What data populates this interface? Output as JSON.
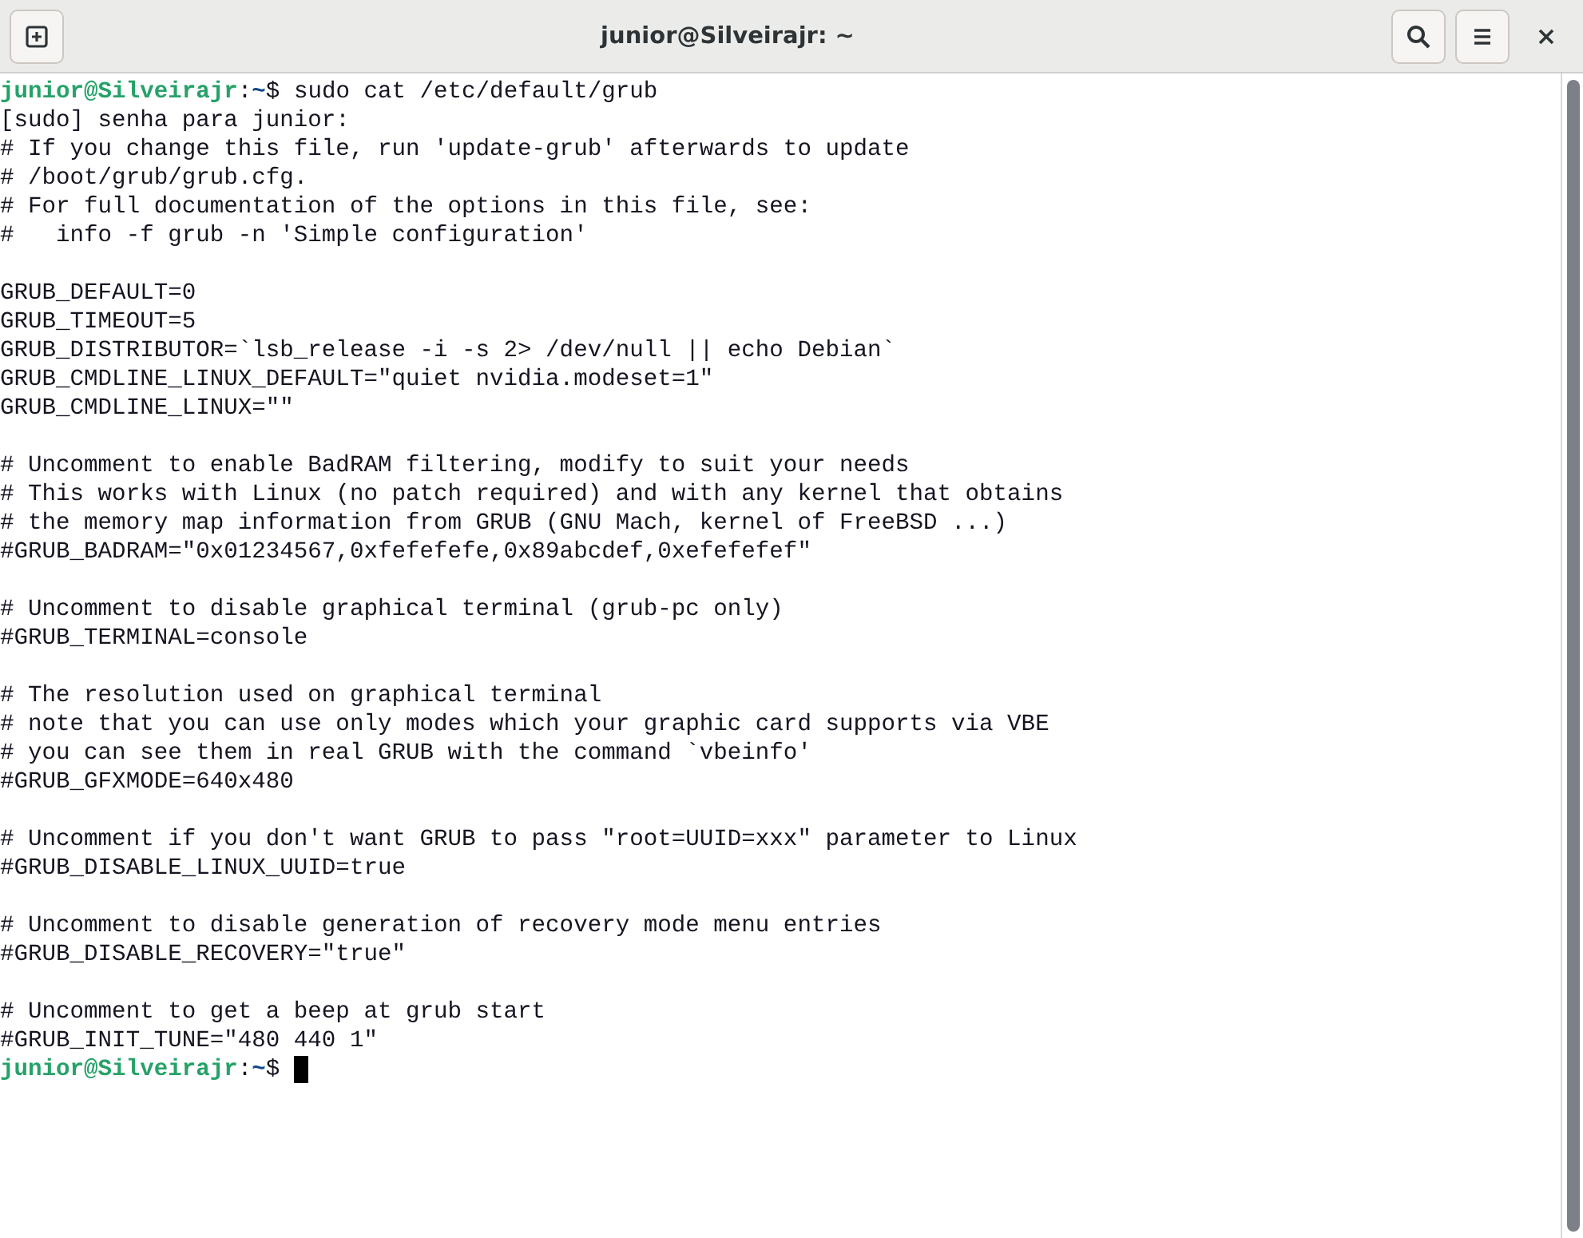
{
  "window": {
    "title": "junior@Silveirajr: ~"
  },
  "lines": [
    {
      "kind": "prompt",
      "user_host": "junior@Silveirajr",
      "separator": ":",
      "path": "~",
      "symbol": "$",
      "command": "sudo cat /etc/default/grub"
    },
    {
      "kind": "output",
      "text": "[sudo] senha para junior:"
    },
    {
      "kind": "output",
      "text": "# If you change this file, run 'update-grub' afterwards to update"
    },
    {
      "kind": "output",
      "text": "# /boot/grub/grub.cfg."
    },
    {
      "kind": "output",
      "text": "# For full documentation of the options in this file, see:"
    },
    {
      "kind": "output",
      "text": "#   info -f grub -n 'Simple configuration'"
    },
    {
      "kind": "blank"
    },
    {
      "kind": "output",
      "text": "GRUB_DEFAULT=0"
    },
    {
      "kind": "output",
      "text": "GRUB_TIMEOUT=5"
    },
    {
      "kind": "output",
      "text": "GRUB_DISTRIBUTOR=`lsb_release -i -s 2> /dev/null || echo Debian`"
    },
    {
      "kind": "output",
      "text": "GRUB_CMDLINE_LINUX_DEFAULT=\"quiet nvidia.modeset=1\""
    },
    {
      "kind": "output",
      "text": "GRUB_CMDLINE_LINUX=\"\""
    },
    {
      "kind": "blank"
    },
    {
      "kind": "output",
      "text": "# Uncomment to enable BadRAM filtering, modify to suit your needs"
    },
    {
      "kind": "output",
      "text": "# This works with Linux (no patch required) and with any kernel that obtains"
    },
    {
      "kind": "output",
      "text": "# the memory map information from GRUB (GNU Mach, kernel of FreeBSD ...)"
    },
    {
      "kind": "output",
      "text": "#GRUB_BADRAM=\"0x01234567,0xfefefefe,0x89abcdef,0xefefefef\""
    },
    {
      "kind": "blank"
    },
    {
      "kind": "output",
      "text": "# Uncomment to disable graphical terminal (grub-pc only)"
    },
    {
      "kind": "output",
      "text": "#GRUB_TERMINAL=console"
    },
    {
      "kind": "blank"
    },
    {
      "kind": "output",
      "text": "# The resolution used on graphical terminal"
    },
    {
      "kind": "output",
      "text": "# note that you can use only modes which your graphic card supports via VBE"
    },
    {
      "kind": "output",
      "text": "# you can see them in real GRUB with the command `vbeinfo'"
    },
    {
      "kind": "output",
      "text": "#GRUB_GFXMODE=640x480"
    },
    {
      "kind": "blank"
    },
    {
      "kind": "output",
      "text": "# Uncomment if you don't want GRUB to pass \"root=UUID=xxx\" parameter to Linux"
    },
    {
      "kind": "output",
      "text": "#GRUB_DISABLE_LINUX_UUID=true"
    },
    {
      "kind": "blank"
    },
    {
      "kind": "output",
      "text": "# Uncomment to disable generation of recovery mode menu entries"
    },
    {
      "kind": "output",
      "text": "#GRUB_DISABLE_RECOVERY=\"true\""
    },
    {
      "kind": "blank"
    },
    {
      "kind": "output",
      "text": "# Uncomment to get a beep at grub start"
    },
    {
      "kind": "output",
      "text": "#GRUB_INIT_TUNE=\"480 440 1\""
    },
    {
      "kind": "prompt",
      "user_host": "junior@Silveirajr",
      "separator": ":",
      "path": "~",
      "symbol": "$",
      "cursor": true
    }
  ]
}
